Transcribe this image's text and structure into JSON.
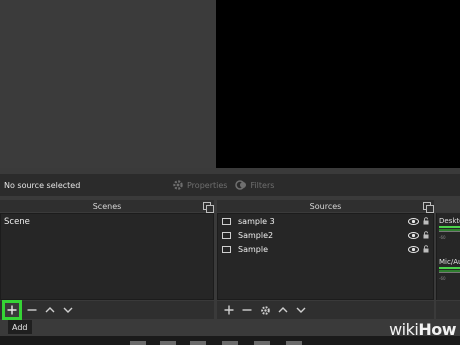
{
  "status": {
    "no_source": "No source selected",
    "properties_label": "Properties",
    "filters_label": "Filters"
  },
  "scenes": {
    "title": "Scenes",
    "items": [
      "Scene"
    ]
  },
  "sources": {
    "title": "Sources",
    "items": [
      "sample 3",
      "Sample2",
      "Sample"
    ]
  },
  "mixer": {
    "channels": [
      "Deskto",
      "Mic/Au"
    ],
    "tick_label": "-60"
  },
  "tooltip": {
    "add": "Add"
  },
  "watermark": {
    "wiki": "wiki",
    "how": "How"
  },
  "colors": {
    "highlight": "#35d435",
    "meter_green": "#4cd44c"
  },
  "icons": {
    "add": "plus-icon",
    "remove": "minus-icon",
    "up": "chevron-up-icon",
    "down": "chevron-down-icon",
    "settings": "gear-icon",
    "visibility": "eye-icon",
    "lock": "lock-icon"
  }
}
